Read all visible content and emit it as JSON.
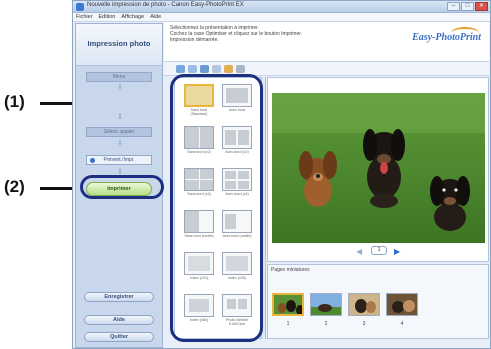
{
  "window": {
    "title": "Nouvelle impression de photo - Canon Easy-PhotoPrint EX",
    "menu": [
      "Fichier",
      "Edition",
      "Affichage",
      "Aide"
    ]
  },
  "callouts": {
    "one": "(1)",
    "two": "(2)"
  },
  "left_panel": {
    "title": "Impression photo",
    "steps": [
      "Menu",
      "Sélect. papier",
      "Présent./Impr."
    ],
    "print_button": "Imprimer",
    "bottom_buttons": [
      "Enregistrer",
      "Aide",
      "Quitter"
    ]
  },
  "header": {
    "instructions": "Sélectionnez la présentation à imprimer.\nCochez la case Optimiser et cliquez sur le bouton Imprimer.\nImpression démarrée.",
    "logo": "Easy-PhotoPrint"
  },
  "layouts": [
    {
      "label": "Sans bord (Standard)"
    },
    {
      "label": "Avec bord"
    },
    {
      "label": "Sans bord (x2)"
    },
    {
      "label": "Avec bord (x2)"
    },
    {
      "label": "Sans bord (x4)"
    },
    {
      "label": "Avec bord (x4)"
    },
    {
      "label": "Sans bord (moitié)"
    },
    {
      "label": "Avec bord (moitié)"
    },
    {
      "label": "Index (x20)"
    },
    {
      "label": "Index (x35)"
    },
    {
      "label": "Index (x80)"
    },
    {
      "label": "Photo identité 5.0x5.0cm"
    }
  ],
  "preview": {
    "page": "1"
  },
  "pages_strip": {
    "label": "Pages miniatures",
    "numbers": [
      "1",
      "2",
      "3",
      "4"
    ]
  },
  "colors": {
    "highlight": "#1c2f80",
    "accent": "#3a6fc4",
    "print_button": "#b7dd88"
  }
}
